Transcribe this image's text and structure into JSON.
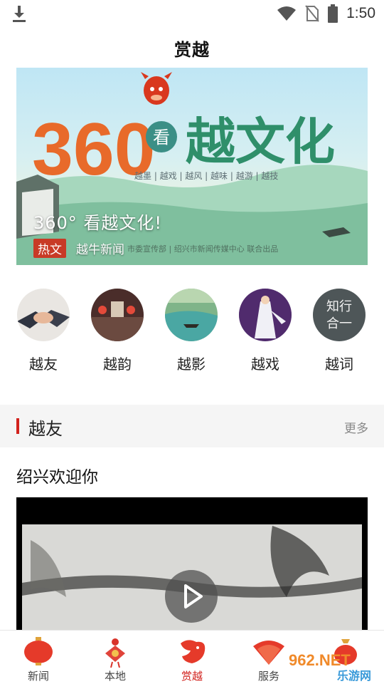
{
  "status_bar": {
    "time": "1:50",
    "icons": [
      "download-icon",
      "wifi-icon",
      "no-sim-icon",
      "battery-icon"
    ]
  },
  "header": {
    "title": "赏越"
  },
  "banner": {
    "poster_number": "360",
    "poster_circle_char": "看",
    "poster_title": "越文化",
    "poster_subtopics": "越墨 | 越戏 | 越风 | 越味 | 越游 | 越技",
    "poster_credits": "市委宣传部 | 绍兴市新闻传媒中心 联合出品",
    "caption": "360° 看越文化!",
    "tag": "热文",
    "source": "越牛新闻"
  },
  "categories": [
    {
      "label": "越友",
      "icon": "handshake-image"
    },
    {
      "label": "越韵",
      "icon": "old-street-image"
    },
    {
      "label": "越影",
      "icon": "river-boat-image"
    },
    {
      "label": "越戏",
      "icon": "opera-performer-image"
    },
    {
      "label": "越词",
      "icon": "calligraphy-image",
      "image_text_top": "知行",
      "image_text_bottom": "合一"
    }
  ],
  "section": {
    "title": "越友",
    "more": "更多"
  },
  "article": {
    "title": "绍兴欢迎你"
  },
  "bottom_nav": [
    {
      "label": "新闻",
      "icon": "lantern-icon",
      "active": false
    },
    {
      "label": "本地",
      "icon": "knot-icon",
      "active": false
    },
    {
      "label": "赏越",
      "icon": "mascot-icon",
      "active": true
    },
    {
      "label": "服务",
      "icon": "fan-icon",
      "active": false
    },
    {
      "label": "",
      "icon": "bag-icon",
      "active": false
    }
  ],
  "watermark": {
    "text_top": "962.NET",
    "text_bottom": "乐游网"
  },
  "colors": {
    "accent": "#d2221d",
    "tag": "#c83a26",
    "section_bg": "#f5f5f5"
  }
}
